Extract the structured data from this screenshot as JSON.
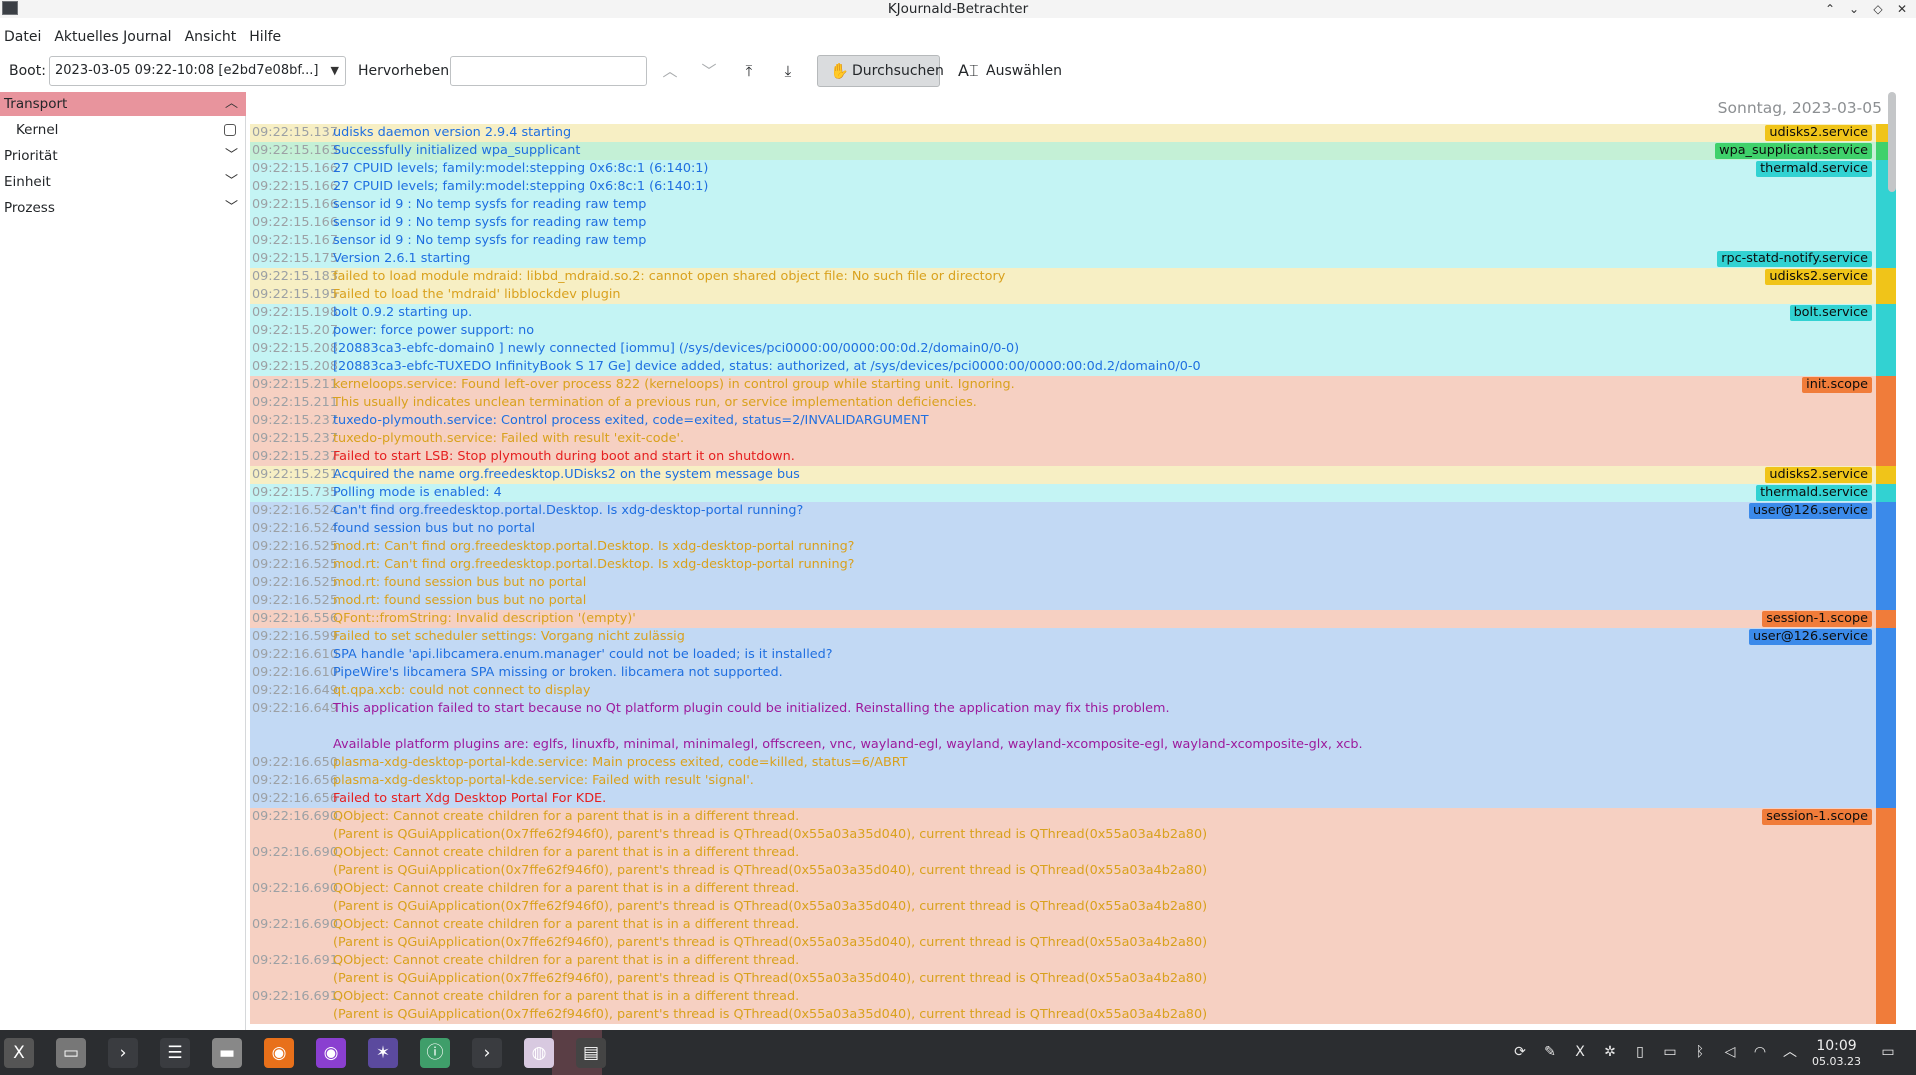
{
  "window": {
    "title": "KJournald-Betrachter"
  },
  "menu": [
    "Datei",
    "Aktuelles Journal",
    "Ansicht",
    "Hilfe"
  ],
  "toolbar": {
    "boot_label": "Boot:",
    "boot_value": "2023-03-05 09:22-10:08 [e2bd7e08bf...]",
    "highlight_label": "Hervorheben:",
    "highlight_value": "",
    "browse_label": "Durchsuchen",
    "select_label": "Auswählen"
  },
  "sidebar": {
    "items": [
      {
        "label": "Transport",
        "expanded": true
      },
      {
        "label": "Kernel",
        "checked": false
      },
      {
        "label": "Priorität",
        "expanded": false
      },
      {
        "label": "Einheit",
        "expanded": false
      },
      {
        "label": "Prozess",
        "expanded": false
      }
    ]
  },
  "log": {
    "day_header": "Sonntag, 2023-03-05",
    "colors": {
      "info": "#1f6fe0",
      "warning": "#d9a11d",
      "error": "#e51f1f",
      "critical": "#9c1a9c",
      "udisks_bg": "#f7efc4",
      "udisks_tag": "#f0c419",
      "wpa_bg": "#c4f0d6",
      "wpa_tag": "#3fd16b",
      "thermald_bg": "#c4f4f4",
      "thermald_tag": "#32d2d2",
      "init_bg": "#f6d0c2",
      "init_tag": "#f07c3a",
      "user_bg": "#c2d9f4",
      "user_tag": "#3b8aea"
    },
    "lines": [
      {
        "ts": "09:22:15.137",
        "msg": "udisks daemon version 2.9.4 starting",
        "lvl": "info",
        "grp": "udisks",
        "tag": "udisks2.service"
      },
      {
        "ts": "09:22:15.163",
        "msg": "Successfully initialized wpa_supplicant",
        "lvl": "info",
        "grp": "wpa",
        "tag": "wpa_supplicant.service"
      },
      {
        "ts": "09:22:15.166",
        "msg": "27 CPUID levels; family:model:stepping 0x6:8c:1 (6:140:1)",
        "lvl": "info",
        "grp": "thermald",
        "tag": "thermald.service"
      },
      {
        "ts": "09:22:15.166",
        "msg": "27 CPUID levels; family:model:stepping 0x6:8c:1 (6:140:1)",
        "lvl": "info",
        "grp": "thermald",
        "tag": ""
      },
      {
        "ts": "09:22:15.166",
        "msg": "sensor id 9 : No temp sysfs for reading raw temp",
        "lvl": "info",
        "grp": "thermald",
        "tag": ""
      },
      {
        "ts": "09:22:15.166",
        "msg": "sensor id 9 : No temp sysfs for reading raw temp",
        "lvl": "info",
        "grp": "thermald",
        "tag": ""
      },
      {
        "ts": "09:22:15.167",
        "msg": "sensor id 9 : No temp sysfs for reading raw temp",
        "lvl": "info",
        "grp": "thermald",
        "tag": ""
      },
      {
        "ts": "09:22:15.175",
        "msg": "Version 2.6.1 starting",
        "lvl": "info",
        "grp": "thermald",
        "tag": "rpc-statd-notify.service"
      },
      {
        "ts": "09:22:15.183",
        "msg": "failed to load module mdraid: libbd_mdraid.so.2: cannot open shared object file: No such file or directory",
        "lvl": "warning",
        "grp": "udisks",
        "tag": "udisks2.service"
      },
      {
        "ts": "09:22:15.195",
        "msg": "Failed to load the 'mdraid' libblockdev plugin",
        "lvl": "warning",
        "grp": "udisks",
        "tag": ""
      },
      {
        "ts": "09:22:15.198",
        "msg": "bolt 0.9.2 starting up.",
        "lvl": "info",
        "grp": "thermald",
        "tag": "bolt.service"
      },
      {
        "ts": "09:22:15.207",
        "msg": "power: force power support: no",
        "lvl": "info",
        "grp": "thermald",
        "tag": ""
      },
      {
        "ts": "09:22:15.208",
        "msg": "[20883ca3-ebfc-domain0                  ] newly connected [iommu] (/sys/devices/pci0000:00/0000:00:0d.2/domain0/0-0)",
        "lvl": "info",
        "grp": "thermald",
        "tag": ""
      },
      {
        "ts": "09:22:15.208",
        "msg": "[20883ca3-ebfc-TUXEDO InfinityBook S 17 Ge] device added, status: authorized, at /sys/devices/pci0000:00/0000:00:0d.2/domain0/0-0",
        "lvl": "info",
        "grp": "thermald",
        "tag": ""
      },
      {
        "ts": "09:22:15.211",
        "msg": "kerneloops.service: Found left-over process 822 (kerneloops) in control group while starting unit. Ignoring.",
        "lvl": "warning",
        "grp": "init",
        "tag": "init.scope"
      },
      {
        "ts": "09:22:15.211",
        "msg": "This usually indicates unclean termination of a previous run, or service implementation deficiencies.",
        "lvl": "warning",
        "grp": "init",
        "tag": ""
      },
      {
        "ts": "09:22:15.237",
        "msg": "tuxedo-plymouth.service: Control process exited, code=exited, status=2/INVALIDARGUMENT",
        "lvl": "info",
        "grp": "init",
        "tag": ""
      },
      {
        "ts": "09:22:15.237",
        "msg": "tuxedo-plymouth.service: Failed with result 'exit-code'.",
        "lvl": "warning",
        "grp": "init",
        "tag": ""
      },
      {
        "ts": "09:22:15.237",
        "msg": "Failed to start LSB: Stop plymouth during boot and start it on shutdown.",
        "lvl": "error",
        "grp": "init",
        "tag": ""
      },
      {
        "ts": "09:22:15.251",
        "msg": "Acquired the name org.freedesktop.UDisks2 on the system message bus",
        "lvl": "info",
        "grp": "udisks",
        "tag": "udisks2.service"
      },
      {
        "ts": "09:22:15.735",
        "msg": "Polling mode is enabled: 4",
        "lvl": "info",
        "grp": "thermald",
        "tag": "thermald.service"
      },
      {
        "ts": "09:22:16.524",
        "msg": "Can't find org.freedesktop.portal.Desktop. Is xdg-desktop-portal running?",
        "lvl": "info",
        "grp": "user",
        "tag": "user@126.service"
      },
      {
        "ts": "09:22:16.524",
        "msg": "found session bus but no portal",
        "lvl": "info",
        "grp": "user",
        "tag": ""
      },
      {
        "ts": "09:22:16.525",
        "msg": "mod.rt: Can't find org.freedesktop.portal.Desktop. Is xdg-desktop-portal running?",
        "lvl": "warning",
        "grp": "user",
        "tag": ""
      },
      {
        "ts": "09:22:16.525",
        "msg": "mod.rt: Can't find org.freedesktop.portal.Desktop. Is xdg-desktop-portal running?",
        "lvl": "warning",
        "grp": "user",
        "tag": ""
      },
      {
        "ts": "09:22:16.525",
        "msg": "mod.rt: found session bus but no portal",
        "lvl": "warning",
        "grp": "user",
        "tag": ""
      },
      {
        "ts": "09:22:16.525",
        "msg": "mod.rt: found session bus but no portal",
        "lvl": "warning",
        "grp": "user",
        "tag": ""
      },
      {
        "ts": "09:22:16.556",
        "msg": "QFont::fromString: Invalid description '(empty)'",
        "lvl": "warning",
        "grp": "init",
        "tag": "session-1.scope"
      },
      {
        "ts": "09:22:16.599",
        "msg": "Failed to set scheduler settings: Vorgang nicht zulässig",
        "lvl": "warning",
        "grp": "user",
        "tag": "user@126.service"
      },
      {
        "ts": "09:22:16.610",
        "msg": "SPA handle 'api.libcamera.enum.manager' could not be loaded; is it installed?",
        "lvl": "info",
        "grp": "user",
        "tag": ""
      },
      {
        "ts": "09:22:16.610",
        "msg": "PipeWire's libcamera SPA missing or broken. libcamera not supported.",
        "lvl": "info",
        "grp": "user",
        "tag": ""
      },
      {
        "ts": "09:22:16.649",
        "msg": "qt.qpa.xcb: could not connect to display",
        "lvl": "warning",
        "grp": "user",
        "tag": ""
      },
      {
        "ts": "09:22:16.649",
        "msg": "This application failed to start because no Qt platform plugin could be initialized. Reinstalling the application may fix this problem.",
        "lvl": "critical",
        "grp": "user",
        "tag": ""
      },
      {
        "ts": "",
        "msg": "",
        "lvl": "critical",
        "grp": "user",
        "tag": ""
      },
      {
        "ts": "",
        "msg": "Available platform plugins are: eglfs, linuxfb, minimal, minimalegl, offscreen, vnc, wayland-egl, wayland, wayland-xcomposite-egl, wayland-xcomposite-glx, xcb.",
        "lvl": "critical",
        "grp": "user",
        "tag": ""
      },
      {
        "ts": "09:22:16.650",
        "msg": "plasma-xdg-desktop-portal-kde.service: Main process exited, code=killed, status=6/ABRT",
        "lvl": "warning",
        "grp": "user",
        "tag": ""
      },
      {
        "ts": "09:22:16.656",
        "msg": "plasma-xdg-desktop-portal-kde.service: Failed with result 'signal'.",
        "lvl": "warning",
        "grp": "user",
        "tag": ""
      },
      {
        "ts": "09:22:16.656",
        "msg": "Failed to start Xdg Desktop Portal For KDE.",
        "lvl": "error",
        "grp": "user",
        "tag": ""
      },
      {
        "ts": "09:22:16.690",
        "msg": "QObject: Cannot create children for a parent that is in a different thread.",
        "lvl": "warning",
        "grp": "init",
        "tag": "session-1.scope"
      },
      {
        "ts": "",
        "msg": "(Parent is QGuiApplication(0x7ffe62f946f0), parent's thread is QThread(0x55a03a35d040), current thread is QThread(0x55a03a4b2a80)",
        "lvl": "warning",
        "grp": "init",
        "tag": ""
      },
      {
        "ts": "09:22:16.690",
        "msg": "QObject: Cannot create children for a parent that is in a different thread.",
        "lvl": "warning",
        "grp": "init",
        "tag": ""
      },
      {
        "ts": "",
        "msg": "(Parent is QGuiApplication(0x7ffe62f946f0), parent's thread is QThread(0x55a03a35d040), current thread is QThread(0x55a03a4b2a80)",
        "lvl": "warning",
        "grp": "init",
        "tag": ""
      },
      {
        "ts": "09:22:16.690",
        "msg": "QObject: Cannot create children for a parent that is in a different thread.",
        "lvl": "warning",
        "grp": "init",
        "tag": ""
      },
      {
        "ts": "",
        "msg": "(Parent is QGuiApplication(0x7ffe62f946f0), parent's thread is QThread(0x55a03a35d040), current thread is QThread(0x55a03a4b2a80)",
        "lvl": "warning",
        "grp": "init",
        "tag": ""
      },
      {
        "ts": "09:22:16.690",
        "msg": "QObject: Cannot create children for a parent that is in a different thread.",
        "lvl": "warning",
        "grp": "init",
        "tag": ""
      },
      {
        "ts": "",
        "msg": "(Parent is QGuiApplication(0x7ffe62f946f0), parent's thread is QThread(0x55a03a35d040), current thread is QThread(0x55a03a4b2a80)",
        "lvl": "warning",
        "grp": "init",
        "tag": ""
      },
      {
        "ts": "09:22:16.691",
        "msg": "QObject: Cannot create children for a parent that is in a different thread.",
        "lvl": "warning",
        "grp": "init",
        "tag": ""
      },
      {
        "ts": "",
        "msg": "(Parent is QGuiApplication(0x7ffe62f946f0), parent's thread is QThread(0x55a03a35d040), current thread is QThread(0x55a03a4b2a80)",
        "lvl": "warning",
        "grp": "init",
        "tag": ""
      },
      {
        "ts": "09:22:16.691",
        "msg": "QObject: Cannot create children for a parent that is in a different thread.",
        "lvl": "warning",
        "grp": "init",
        "tag": ""
      },
      {
        "ts": "",
        "msg": "(Parent is QGuiApplication(0x7ffe62f946f0), parent's thread is QThread(0x55a03a35d040), current thread is QThread(0x55a03a4b2a80)",
        "lvl": "warning",
        "grp": "init",
        "tag": ""
      }
    ]
  },
  "taskbar": {
    "apps": [
      "launcher-icon",
      "files-icon",
      "terminal-icon",
      "settings-icon",
      "file-manager-icon",
      "firefox-icon",
      "firefox-dev-icon",
      "network-tool-icon",
      "info-center-icon",
      "konsole-icon",
      "browser-icon",
      "kjournald-icon"
    ],
    "tray": [
      "updates-icon",
      "pen-icon",
      "x-icon",
      "network-icon",
      "clipboard-icon",
      "battery-icon",
      "bluetooth-icon",
      "volume-icon",
      "wifi-icon",
      "expand-icon"
    ],
    "time": "10:09",
    "date": "05.03.23"
  }
}
